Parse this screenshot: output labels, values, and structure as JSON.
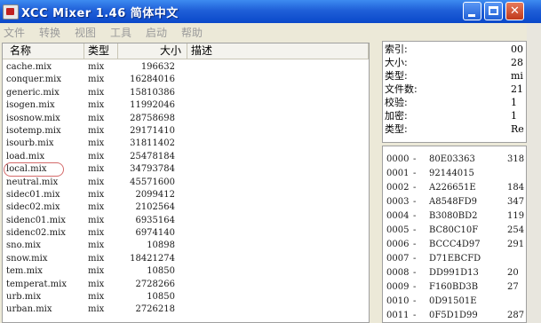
{
  "window": {
    "title": "XCC Mixer 1.46 简体中文",
    "min_label": "_",
    "max_label": "□",
    "close_label": "✕"
  },
  "menu": [
    "文件",
    "转换",
    "视图",
    "工具",
    "启动",
    "帮助"
  ],
  "list": {
    "headers": {
      "name": "名称",
      "type": "类型",
      "size": "大小",
      "desc": "描述"
    },
    "rows": [
      {
        "name": "cache.mix",
        "type": "mix",
        "size": "196632"
      },
      {
        "name": "conquer.mix",
        "type": "mix",
        "size": "16284016"
      },
      {
        "name": "generic.mix",
        "type": "mix",
        "size": "15810386"
      },
      {
        "name": "isogen.mix",
        "type": "mix",
        "size": "11992046"
      },
      {
        "name": "isosnow.mix",
        "type": "mix",
        "size": "28758698"
      },
      {
        "name": "isotemp.mix",
        "type": "mix",
        "size": "29171410"
      },
      {
        "name": "isourb.mix",
        "type": "mix",
        "size": "31811402"
      },
      {
        "name": "load.mix",
        "type": "mix",
        "size": "25478184"
      },
      {
        "name": "local.mix",
        "type": "mix",
        "size": "34793784",
        "highlighted": true
      },
      {
        "name": "neutral.mix",
        "type": "mix",
        "size": "45571600"
      },
      {
        "name": "sidec01.mix",
        "type": "mix",
        "size": "2099412"
      },
      {
        "name": "sidec02.mix",
        "type": "mix",
        "size": "2102564"
      },
      {
        "name": "sidenc01.mix",
        "type": "mix",
        "size": "6935164"
      },
      {
        "name": "sidenc02.mix",
        "type": "mix",
        "size": "6974140"
      },
      {
        "name": "sno.mix",
        "type": "mix",
        "size": "10898"
      },
      {
        "name": "snow.mix",
        "type": "mix",
        "size": "18421274"
      },
      {
        "name": "tem.mix",
        "type": "mix",
        "size": "10850"
      },
      {
        "name": "temperat.mix",
        "type": "mix",
        "size": "2728266"
      },
      {
        "name": "urb.mix",
        "type": "mix",
        "size": "10850"
      },
      {
        "name": "urban.mix",
        "type": "mix",
        "size": "2726218"
      }
    ]
  },
  "info": [
    {
      "label": "索引:",
      "value": "00"
    },
    {
      "label": "大小:",
      "value": "28"
    },
    {
      "label": "类型:",
      "value": "mi"
    },
    {
      "label": "文件数:",
      "value": "21"
    },
    {
      "label": "校验:",
      "value": "1"
    },
    {
      "label": "加密:",
      "value": "1"
    },
    {
      "label": "类型:",
      "value": "Re"
    }
  ],
  "hex": [
    {
      "addr": "0000",
      "hash": "80E03363",
      "extra": "318"
    },
    {
      "addr": "0001",
      "hash": "92144015",
      "extra": ""
    },
    {
      "addr": "0002",
      "hash": "A226651E",
      "extra": "184"
    },
    {
      "addr": "0003",
      "hash": "A8548FD9",
      "extra": "347"
    },
    {
      "addr": "0004",
      "hash": "B3080BD2",
      "extra": "119"
    },
    {
      "addr": "0005",
      "hash": "BC80C10F",
      "extra": "254"
    },
    {
      "addr": "0006",
      "hash": "BCCC4D97",
      "extra": "291"
    },
    {
      "addr": "0007",
      "hash": "D71EBCFD",
      "extra": ""
    },
    {
      "addr": "0008",
      "hash": "DD991D13",
      "extra": "20"
    },
    {
      "addr": "0009",
      "hash": "F160BD3B",
      "extra": "27"
    },
    {
      "addr": "0010",
      "hash": "0D91501E",
      "extra": ""
    },
    {
      "addr": "0011",
      "hash": "0F5D1D99",
      "extra": "287"
    }
  ]
}
